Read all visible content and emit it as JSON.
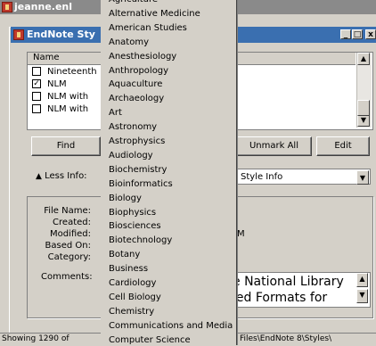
{
  "outer_window": {
    "title": "jeanne.enl"
  },
  "dialog": {
    "title": "EndNote Sty",
    "minimize_symbol": "_",
    "restore_symbol": "□",
    "close_symbol": "x"
  },
  "table": {
    "header": "Name",
    "rows": [
      {
        "label": "Nineteenth",
        "checked": false
      },
      {
        "label": "NLM",
        "checked": true
      },
      {
        "label": "NLM with",
        "checked": false
      },
      {
        "label": "NLM with",
        "checked": false
      }
    ]
  },
  "buttons": {
    "find": "Find",
    "unmark_all": "Unmark All",
    "edit": "Edit"
  },
  "less_info": {
    "label": "Less Info:",
    "select_value": "Style Info"
  },
  "info": {
    "file_name_label": "File Name:",
    "created_label": "Created:",
    "modified_label": "Modified:",
    "based_on_label": "Based On:",
    "category_label": "Category:",
    "comments_label": "Comments:",
    "modified_value_fragment": "M",
    "comments_line1": "e National Library",
    "comments_line2": "led Formats for"
  },
  "status": {
    "left": "Showing 1290 of",
    "right": "Files\\EndNote 8\\Styles\\"
  },
  "category_list": [
    "Agriculture",
    "Alternative Medicine",
    "American Studies",
    "Anatomy",
    "Anesthesiology",
    "Anthropology",
    "Aquaculture",
    "Archaeology",
    "Art",
    "Astronomy",
    "Astrophysics",
    "Audiology",
    "Biochemistry",
    "Bioinformatics",
    "Biology",
    "Biophysics",
    "Biosciences",
    "Biotechnology",
    "Botany",
    "Business",
    "Cardiology",
    "Cell Biology",
    "Chemistry",
    "Communications and Media",
    "Computer Science"
  ],
  "icons": {
    "app": "endnote-app-icon",
    "up": "arrow-up-icon",
    "down": "arrow-down-icon"
  }
}
